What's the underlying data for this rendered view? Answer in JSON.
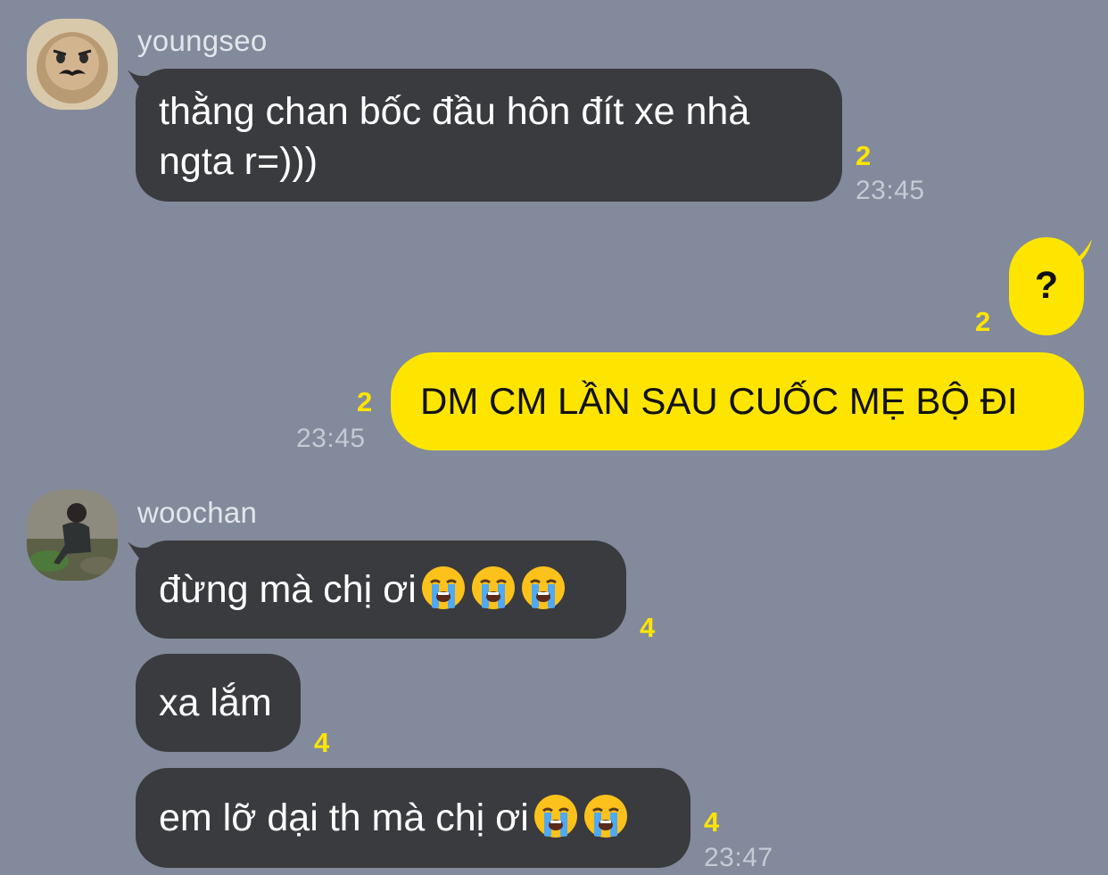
{
  "chat": {
    "messages": [
      {
        "sender": "youngseo",
        "text_line1": "thằng chan bốc đầu hôn đít xe nhà",
        "text_line2": "ngta r=)))",
        "unread": "2",
        "time": "23:45"
      },
      {
        "sender": "me",
        "text": "?",
        "unread": "2"
      },
      {
        "sender": "me",
        "text": "DM CM LẦN SAU CUỐC MẸ BỘ ĐI",
        "unread": "2",
        "time": "23:45"
      },
      {
        "sender": "woochan",
        "text": "đừng mà chị ơi",
        "unread": "4"
      },
      {
        "sender": "woochan",
        "text": "xa lắm",
        "unread": "4"
      },
      {
        "sender": "woochan",
        "text": "em lỡ dại th mà chị ơi",
        "unread": "4",
        "time": "23:47"
      }
    ],
    "participants": {
      "youngseo": {
        "name": "youngseo"
      },
      "woochan": {
        "name": "woochan"
      }
    },
    "emoji": "loudly-crying-face",
    "colors": {
      "background": "#828a9b",
      "incoming_bubble": "#3a3b3f",
      "outgoing_bubble": "#fee500",
      "unread_count": "#fee500"
    }
  }
}
